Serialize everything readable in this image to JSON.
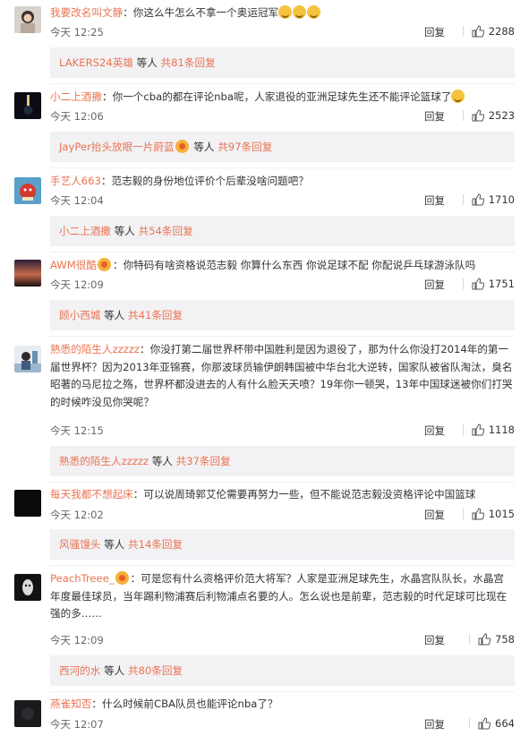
{
  "colors": {
    "link": "#eb7350",
    "subbox_bg": "#f2f2f5",
    "text": "#333333"
  },
  "comments": [
    {
      "user": "我要改名叫文静",
      "sep": "：",
      "content": "你这么牛怎么不拿一个奥运冠军",
      "time": "今天 12:25",
      "reply": "回复",
      "likes": "2288",
      "sub_user": "LAKERS24英雄",
      "sub_mid": "等人",
      "sub_count": "共81条回复"
    },
    {
      "user": "小二上酒撒",
      "sep": "：",
      "content": "你一个cba的都在评论nba呢，人家退役的亚洲足球先生还不能评论篮球了",
      "time": "今天 12:06",
      "reply": "回复",
      "likes": "2523",
      "sub_user": "JayPer抬头放眼一片蔚蓝",
      "sub_mid": "等人",
      "sub_count": "共97条回复"
    },
    {
      "user": "手艺人663",
      "sep": "：",
      "content": "范志毅的身份地位评价个后辈没啥问题吧？",
      "time": "今天 12:04",
      "reply": "回复",
      "likes": "1710",
      "sub_user": "小二上酒撒",
      "sub_mid": "等人",
      "sub_count": "共54条回复"
    },
    {
      "user": "AWM很酷",
      "sep": "：",
      "content": "你特码有啥资格说范志毅  你算什么东西  你说足球不配  你配说乒乓球游泳队吗",
      "time": "今天 12:09",
      "reply": "回复",
      "likes": "1751",
      "sub_user": "顾小西城",
      "sub_mid": "等人",
      "sub_count": "共41条回复"
    },
    {
      "user": "熟悉的陌生人zzzzz",
      "sep": "：",
      "content": "你没打第二届世界杯带中国胜利是因为退役了，那为什么你没打2014年的第一届世界杯？因为2013年亚锦赛，你那波球员输伊朗韩国被中华台北大逆转，国家队被省队淘汰，臭名昭著的马尼拉之殇，世界杯都没进去的人有什么脸天天喷？19年你一顿哭，13年中国球迷被你们打哭的时候咋没见你哭呢？",
      "time": "今天 12:15",
      "reply": "回复",
      "likes": "1118",
      "sub_user": "熟悉的陌生人zzzzz",
      "sub_mid": "等人",
      "sub_count": "共37条回复"
    },
    {
      "user": "每天我都不想起床",
      "sep": "：",
      "content": "可以说周琦郭艾伦需要再努力一些，但不能说范志毅没资格评论中国篮球",
      "time": "今天 12:02",
      "reply": "回复",
      "likes": "1015",
      "sub_user": "风骚馒头",
      "sub_mid": "等人",
      "sub_count": "共14条回复"
    },
    {
      "user": "PeachTreee_",
      "sep": "：",
      "content": "可是您有什么资格评价范大将军？人家是亚洲足球先生，水晶宫队队长，水晶宫年度最佳球员，当年踢利物浦赛后利物浦点名要的人。怎么说也是前辈，范志毅的时代足球可比现在强的多……",
      "time": "今天 12:09",
      "reply": "回复",
      "likes": "758",
      "sub_user": "西河的水",
      "sub_mid": "等人",
      "sub_count": "共80条回复"
    },
    {
      "user": "燕雀知否",
      "sep": "：",
      "content": "什么时候前CBA队员也能评论nba了？",
      "time": "今天 12:07",
      "reply": "回复",
      "likes": "664"
    }
  ]
}
